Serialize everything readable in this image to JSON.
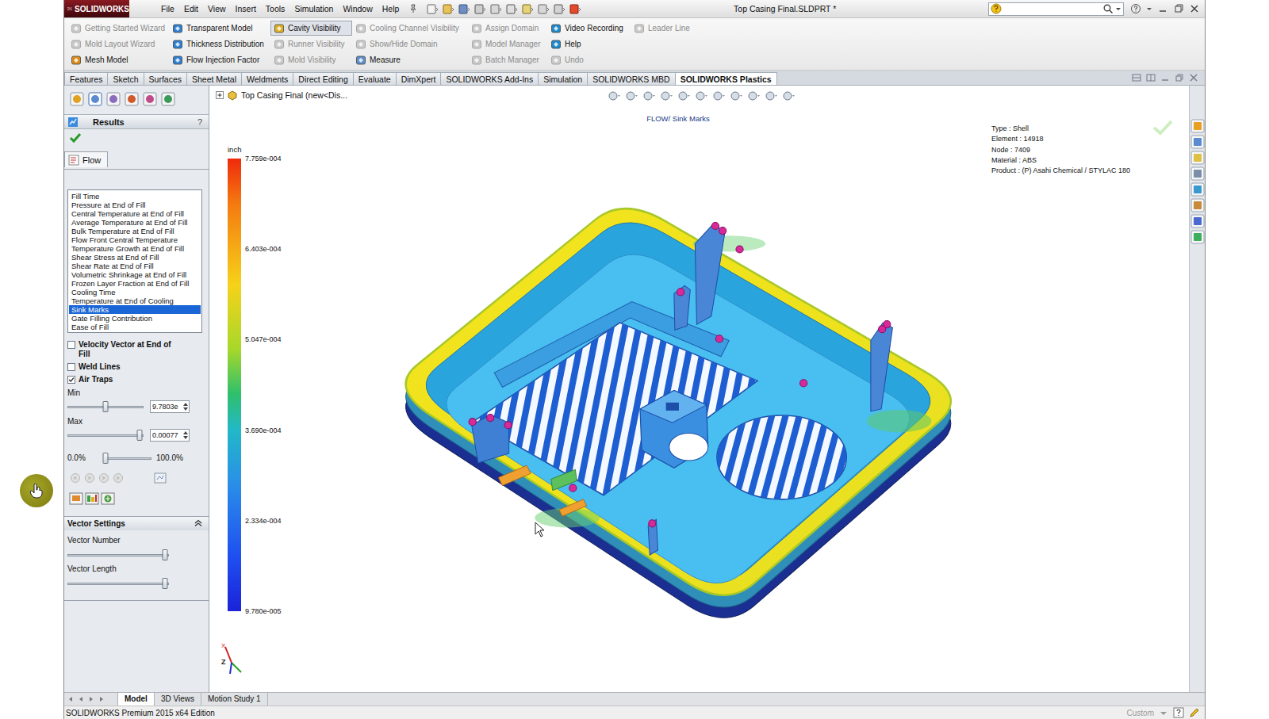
{
  "app": {
    "logo": "SOLIDWORKS",
    "title": "Top Casing Final.SLDPRT *"
  },
  "menu": [
    "File",
    "Edit",
    "View",
    "Insert",
    "Tools",
    "Simulation",
    "Window",
    "Help"
  ],
  "commands": [
    [
      {
        "label": "Getting Started Wizard",
        "disabled": true,
        "selected": false
      },
      {
        "label": "Mold Layout Wizard",
        "disabled": true,
        "selected": false
      },
      {
        "label": "Mesh Model",
        "disabled": false,
        "selected": false
      }
    ],
    [
      {
        "label": "Transparent Model",
        "disabled": false,
        "selected": false
      },
      {
        "label": "Thickness Distribution",
        "disabled": false,
        "selected": false
      },
      {
        "label": "Flow Injection Factor",
        "disabled": false,
        "selected": false
      }
    ],
    [
      {
        "label": "Cavity Visibility",
        "disabled": false,
        "selected": true
      },
      {
        "label": "Runner Visibility",
        "disabled": true,
        "selected": false
      },
      {
        "label": "Mold Visibility",
        "disabled": true,
        "selected": false
      }
    ],
    [
      {
        "label": "Cooling Channel Visibility",
        "disabled": true,
        "selected": false
      },
      {
        "label": "Show/Hide Domain",
        "disabled": true,
        "selected": false
      },
      {
        "label": "Measure",
        "disabled": false,
        "selected": false
      }
    ],
    [
      {
        "label": "Assign Domain",
        "disabled": true,
        "selected": false
      },
      {
        "label": "Model Manager",
        "disabled": true,
        "selected": false
      },
      {
        "label": "Batch Manager",
        "disabled": true,
        "selected": false
      }
    ],
    [
      {
        "label": "Video Recording",
        "disabled": false,
        "selected": false
      },
      {
        "label": "Help",
        "disabled": false,
        "selected": false
      },
      {
        "label": "Undo",
        "disabled": true,
        "selected": false
      }
    ],
    [
      {
        "label": "Leader Line",
        "disabled": true,
        "selected": false
      }
    ]
  ],
  "tabs": [
    {
      "label": "Features",
      "selected": false
    },
    {
      "label": "Sketch",
      "selected": false
    },
    {
      "label": "Surfaces",
      "selected": false
    },
    {
      "label": "Sheet Metal",
      "selected": false
    },
    {
      "label": "Weldments",
      "selected": false
    },
    {
      "label": "Direct Editing",
      "selected": false
    },
    {
      "label": "Evaluate",
      "selected": false
    },
    {
      "label": "DimXpert",
      "selected": false
    },
    {
      "label": "SOLIDWORKS Add-Ins",
      "selected": false
    },
    {
      "label": "Simulation",
      "selected": false
    },
    {
      "label": "SOLIDWORKS MBD",
      "selected": false
    },
    {
      "label": "SOLIDWORKS Plastics",
      "selected": true
    }
  ],
  "feature_tree": {
    "label": "Top Casing Final (new<Dis..."
  },
  "property_manager": {
    "title": "Results",
    "help": "?",
    "tab": "Flow",
    "results": [
      {
        "label": "Fill Time",
        "selected": false
      },
      {
        "label": "Pressure at End of Fill",
        "selected": false
      },
      {
        "label": "Central Temperature at End of Fill",
        "selected": false
      },
      {
        "label": "Average Temperature at End of Fill",
        "selected": false
      },
      {
        "label": "Bulk Temperature at End of Fill",
        "selected": false
      },
      {
        "label": "Flow Front Central Temperature",
        "selected": false
      },
      {
        "label": "Temperature Growth at End of Fill",
        "selected": false
      },
      {
        "label": "Shear Stress at End of Fill",
        "selected": false
      },
      {
        "label": "Shear Rate at End of Fill",
        "selected": false
      },
      {
        "label": "Volumetric Shrinkage at End of Fill",
        "selected": false
      },
      {
        "label": "Frozen Layer Fraction at End of Fill",
        "selected": false
      },
      {
        "label": "Cooling Time",
        "selected": false
      },
      {
        "label": "Temperature at End of Cooling",
        "selected": false
      },
      {
        "label": "Sink Marks",
        "selected": true
      },
      {
        "label": "Gate Filling Contribution",
        "selected": false
      },
      {
        "label": "Ease of Fill",
        "selected": false
      }
    ],
    "options": [
      {
        "label": "Velocity Vector at End of Fill",
        "checked": false
      },
      {
        "label": "Weld Lines",
        "checked": false
      },
      {
        "label": "Air Traps",
        "checked": true
      }
    ],
    "min": {
      "label": "Min",
      "level": 0.5,
      "value": "9.7803e"
    },
    "max": {
      "label": "Max",
      "level": 0.95,
      "value": "0.00077"
    },
    "range": {
      "from": "0.0%",
      "to": "100.0%",
      "level": 0.0
    },
    "vector_settings": {
      "title": "Vector Settings",
      "expanded": true,
      "sliders": [
        {
          "label": "Vector Number",
          "level": 0.96
        },
        {
          "label": "Vector Length",
          "level": 0.96
        }
      ]
    }
  },
  "plot": {
    "title": "FLOW/ Sink Marks",
    "unit": "inch",
    "ticks": [
      "7.759e-004",
      "6.403e-004",
      "5.047e-004",
      "3.690e-004",
      "2.334e-004",
      "9.780e-005"
    ],
    "info": [
      "Type : Shell",
      "Element : 14918",
      "Node : 7409",
      "Material : ABS",
      "Product : (P) Asahi Chemical / STYLAC 180"
    ]
  },
  "triad": [
    "X",
    "Z"
  ],
  "bottom_tabs": [
    {
      "label": "Model",
      "selected": true
    },
    {
      "label": "3D Views",
      "selected": false
    },
    {
      "label": "Motion Study 1",
      "selected": false
    }
  ],
  "status_bar": {
    "text": "SOLIDWORKS Premium 2015 x64 Edition",
    "units": "Custom"
  }
}
